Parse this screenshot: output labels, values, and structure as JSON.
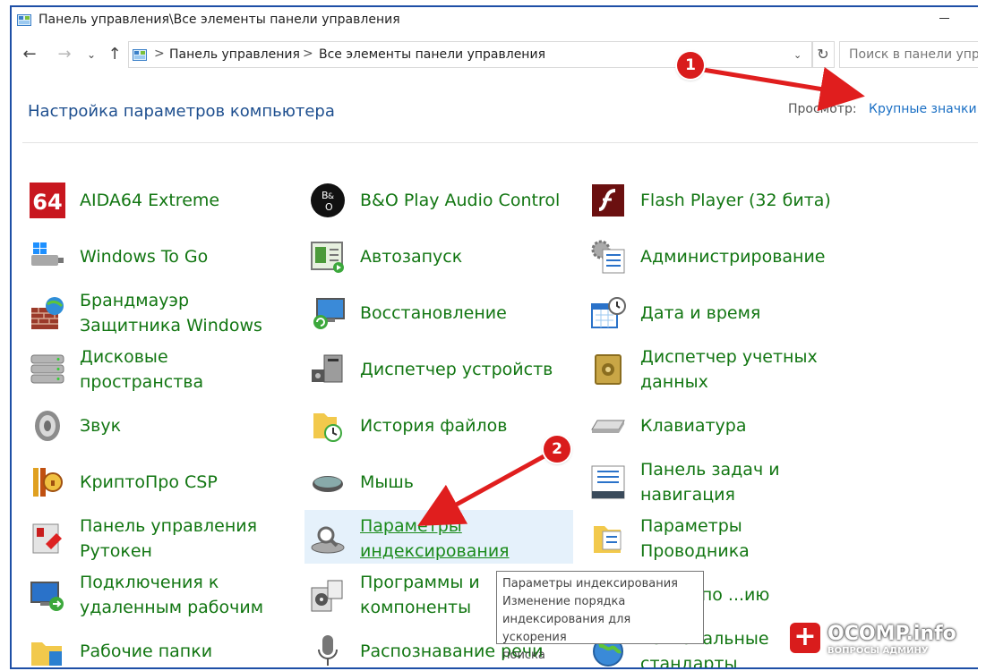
{
  "window": {
    "title": "Панель управления\\Все элементы панели управления"
  },
  "navigation": {
    "back": "←",
    "forward": "→",
    "dropdown": "⌄",
    "up": "↑",
    "separator": ">",
    "breadcrumb": [
      "Панель управления",
      "Все элементы панели управления"
    ],
    "search_placeholder": "Поиск в панели упра"
  },
  "header": {
    "title": "Настройка параметров компьютера",
    "view_label": "Просмотр:",
    "view_value": "Крупные значки ▾"
  },
  "items": [
    {
      "label": "AIDA64 Extreme",
      "icon": "aida64-icon"
    },
    {
      "label": "Windows To Go",
      "icon": "usb-drive-icon"
    },
    {
      "label": "Брандмауэр Защитника Windows",
      "icon": "firewall-icon"
    },
    {
      "label": "Дисковые пространства",
      "icon": "storage-spaces-icon"
    },
    {
      "label": "Звук",
      "icon": "speaker-icon"
    },
    {
      "label": "КриптоПро CSP",
      "icon": "cryptopro-icon"
    },
    {
      "label": "Панель управления Рутокен",
      "icon": "rutoken-icon"
    },
    {
      "label": "Подключения к удаленным рабочим",
      "icon": "remote-desktop-icon"
    },
    {
      "label": "Рабочие папки",
      "icon": "work-folders-icon"
    },
    {
      "label": "B&O Play Audio Control",
      "icon": "bang-olufsen-icon"
    },
    {
      "label": "Автозапуск",
      "icon": "autoplay-icon"
    },
    {
      "label": "Восстановление",
      "icon": "recovery-icon"
    },
    {
      "label": "Диспетчер устройств",
      "icon": "device-manager-icon"
    },
    {
      "label": "История файлов",
      "icon": "file-history-icon"
    },
    {
      "label": "Мышь",
      "icon": "mouse-icon"
    },
    {
      "label": "Параметры индексирования",
      "icon": "indexing-icon"
    },
    {
      "label": "Программы и компоненты",
      "icon": "programs-icon"
    },
    {
      "label": "Распознавание речи",
      "icon": "microphone-icon"
    },
    {
      "label": "Flash Player (32 бита)",
      "icon": "flash-player-icon"
    },
    {
      "label": "Администрирование",
      "icon": "administration-icon"
    },
    {
      "label": "Дата и время",
      "icon": "calendar-clock-icon"
    },
    {
      "label": "Диспетчер учетных данных",
      "icon": "credential-vault-icon"
    },
    {
      "label": "Клавиатура",
      "icon": "keyboard-icon"
    },
    {
      "label": "Панель задач и навигация",
      "icon": "taskbar-icon"
    },
    {
      "label": "Параметры Проводника",
      "icon": "folder-options-icon"
    },
    {
      "label": "...ммы по ...ию",
      "icon": "default-programs-icon"
    },
    {
      "label": "Региональные стандарты",
      "icon": "region-icon"
    }
  ],
  "tooltip": {
    "lines": [
      "Параметры индексирования",
      "Изменение порядка",
      "индексирования для ускорения",
      "поиска"
    ]
  },
  "annotations": {
    "badge1": "1",
    "badge2": "2",
    "arrow_color": "#e01e1e"
  },
  "watermark": {
    "plus": "+",
    "brand": "OCOMP.info",
    "tagline": "ВОПРОСЫ АДМИНУ"
  }
}
